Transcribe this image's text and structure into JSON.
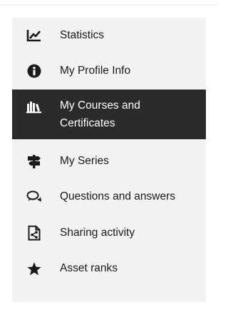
{
  "menu": {
    "items": [
      {
        "label": "Statistics",
        "icon": "chart-line-icon"
      },
      {
        "label": "My Profile Info",
        "icon": "info-circle-icon"
      },
      {
        "label": "My Courses and Certificates",
        "icon": "library-icon",
        "active": true
      },
      {
        "label": "My Series",
        "icon": "signpost-icon"
      },
      {
        "label": "Questions and answers",
        "icon": "speech-bubbles-icon"
      },
      {
        "label": "Sharing activity",
        "icon": "share-file-icon"
      },
      {
        "label": "Asset ranks",
        "icon": "star-icon"
      }
    ]
  },
  "colors": {
    "panel_background": "#f2f2f2",
    "active_background": "#2b2b2b",
    "active_text": "#ffffff",
    "text": "#1a1a1a"
  }
}
